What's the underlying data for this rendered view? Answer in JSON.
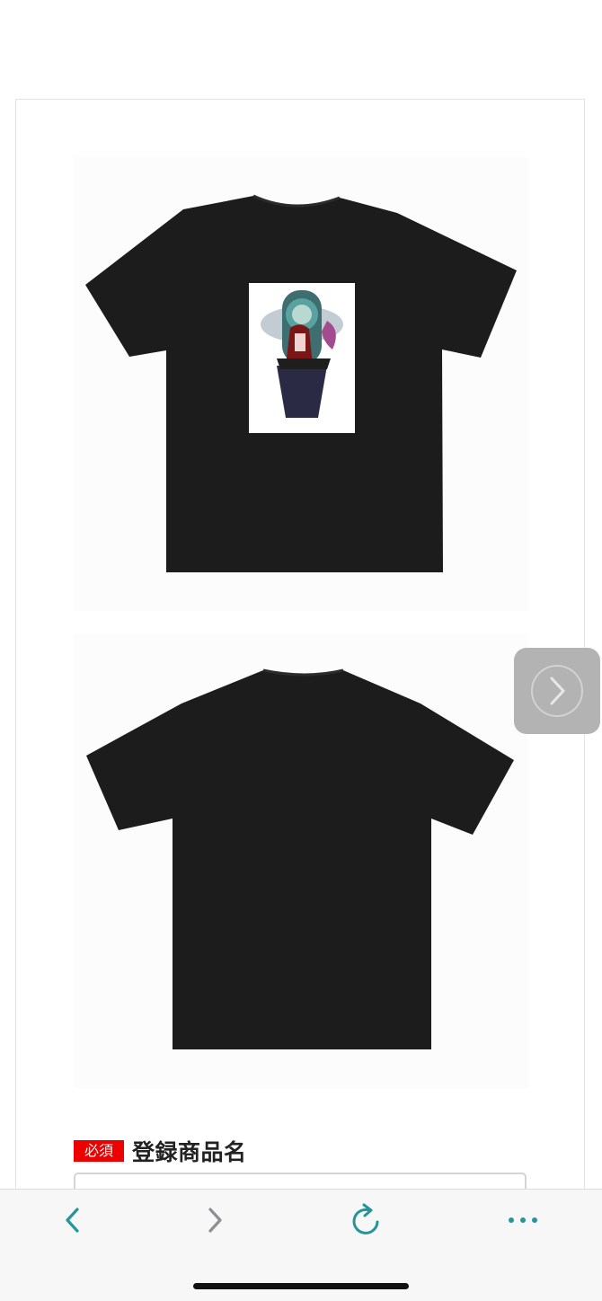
{
  "product": {
    "previews": [
      {
        "view": "front",
        "garment_color": "#1c1c1c",
        "has_print": true
      },
      {
        "view": "back",
        "garment_color": "#1c1c1c",
        "has_print": false
      }
    ],
    "next_icon": "chevron-right-icon"
  },
  "form": {
    "required_badge": "必須",
    "product_name_label": "登録商品名",
    "product_name_value": ""
  },
  "browser_toolbar": {
    "back_icon": "chevron-left-icon",
    "forward_icon": "chevron-right-icon",
    "reload_icon": "reload-icon",
    "more_icon": "more-icon",
    "accent_color": "#23959b",
    "disabled_color": "#8e8e93"
  }
}
